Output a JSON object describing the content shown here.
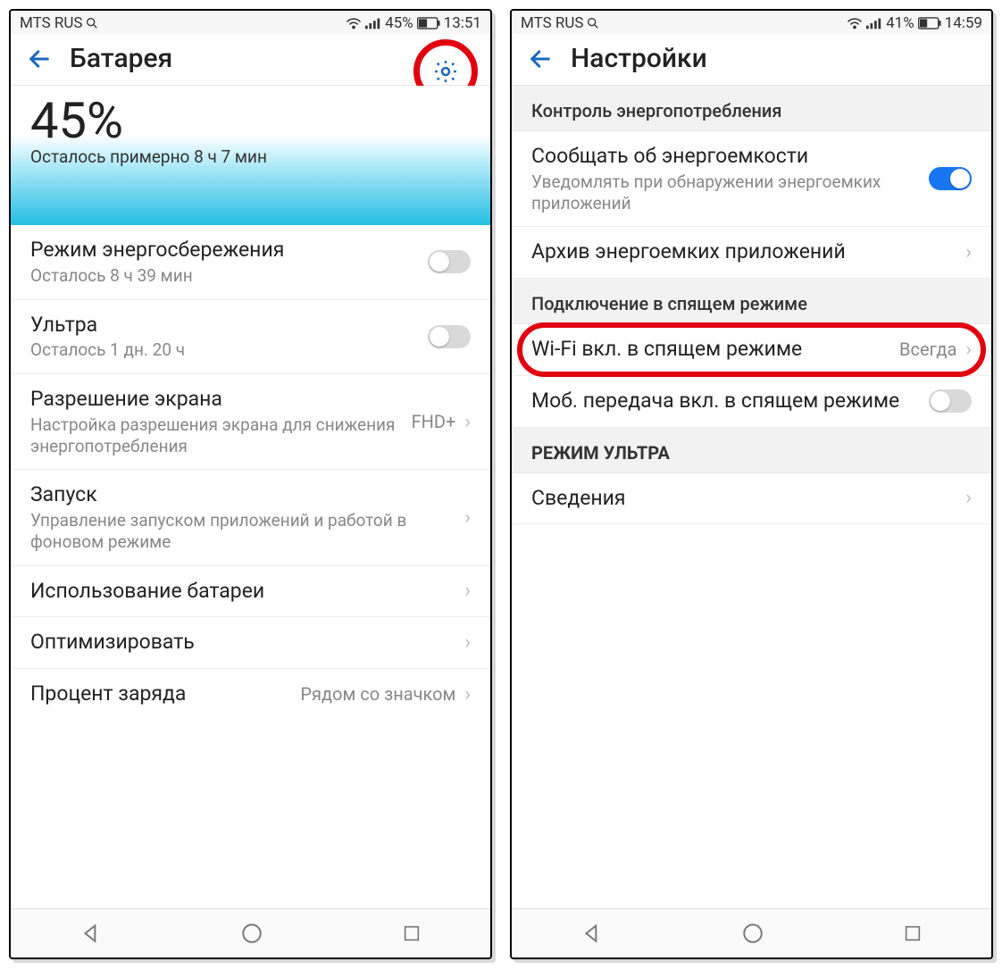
{
  "left": {
    "status": {
      "carrier": "MTS RUS",
      "battery_pct": "45%",
      "time": "13:51"
    },
    "header": {
      "title": "Батарея"
    },
    "hero": {
      "percent": "45%",
      "remaining": "Осталось примерно 8 ч 7 мин"
    },
    "rows": {
      "psave": {
        "title": "Режим энергосбережения",
        "sub": "Осталось 8 ч 39 мин"
      },
      "ultra": {
        "title": "Ультра",
        "sub": "Осталось 1 дн. 20 ч"
      },
      "res": {
        "title": "Разрешение экрана",
        "sub": "Настройка разрешения экрана для снижения энергопотребления",
        "value": "FHD+"
      },
      "launch": {
        "title": "Запуск",
        "sub": "Управление запуском приложений и работой в фоновом режиме"
      },
      "usage": {
        "title": "Использование батареи"
      },
      "opt": {
        "title": "Оптимизировать"
      },
      "pct": {
        "title": "Процент заряда",
        "value": "Рядом со значком"
      }
    }
  },
  "right": {
    "status": {
      "carrier": "MTS RUS",
      "battery_pct": "41%",
      "time": "14:59"
    },
    "header": {
      "title": "Настройки"
    },
    "sections": {
      "s1": "Контроль энергопотребления",
      "s2": "Подключение в спящем режиме",
      "s3": "РЕЖИМ УЛЬТРА"
    },
    "rows": {
      "notify": {
        "title": "Сообщать об энергоемкости",
        "sub": "Уведомлять при обнаружении энергоемких приложений"
      },
      "archive": {
        "title": "Архив энергоемких приложений"
      },
      "wifi": {
        "title": "Wi-Fi вкл. в спящем режиме",
        "value": "Всегда"
      },
      "mobile": {
        "title": "Моб. передача вкл. в спящем режиме"
      },
      "info": {
        "title": "Сведения"
      }
    }
  }
}
